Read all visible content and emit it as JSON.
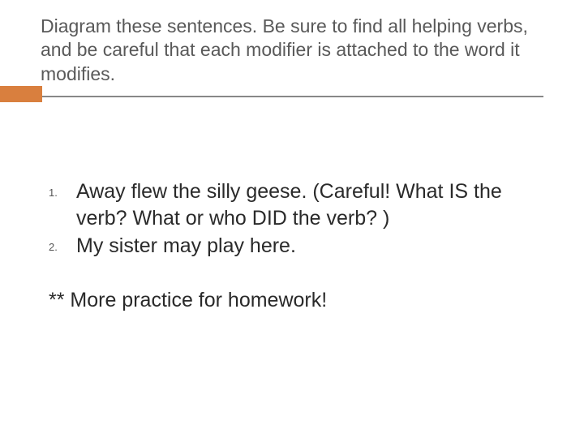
{
  "title": "Diagram these sentences. Be sure to find all helping verbs, and be careful that each modifier is attached to the word it modifies.",
  "sentences": [
    "Away flew the silly geese. (Careful! What IS the verb? What or who DID the verb? )",
    "My sister may play here."
  ],
  "footnote": "** More practice for homework!"
}
